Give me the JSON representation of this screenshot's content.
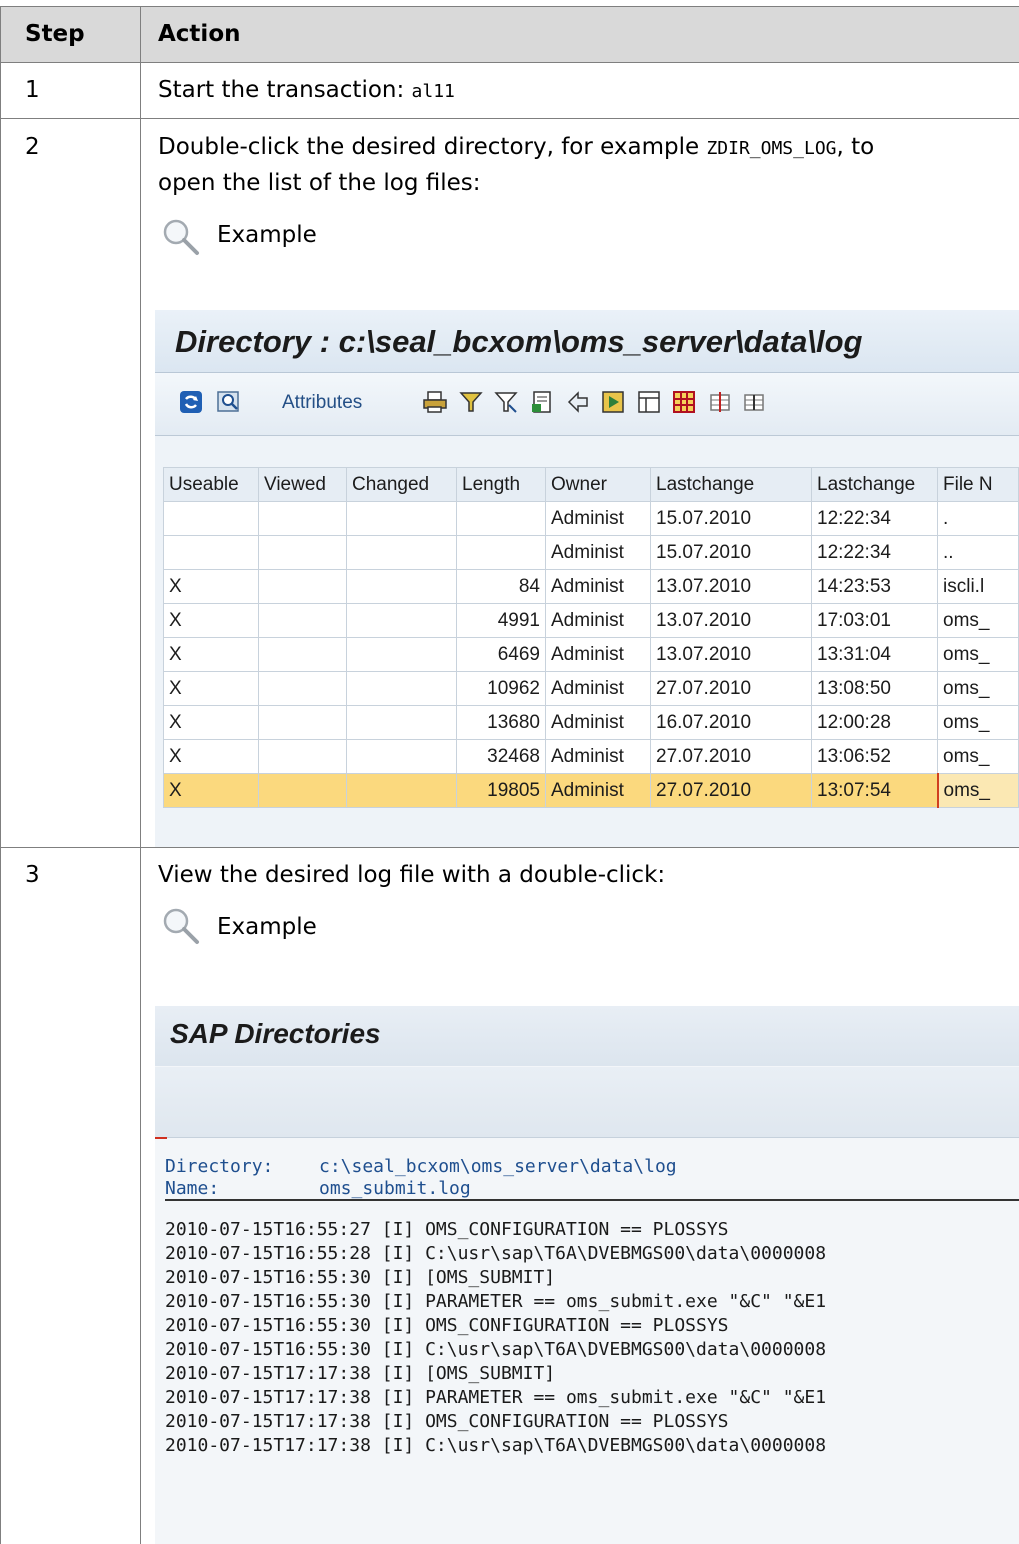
{
  "table": {
    "header": {
      "step": "Step",
      "action": "Action"
    }
  },
  "steps": [
    {
      "number": "1",
      "text": "Start the transaction: ",
      "code": "al11"
    },
    {
      "number": "2",
      "line1_a": "Double-click the desired directory, for example ",
      "line1_code": "ZDIR_OMS_LOG",
      "line1_b": ", to",
      "line2": "open the list of the log files:",
      "example_label": "Example"
    },
    {
      "number": "3",
      "text": "View the desired log file with a double-click:",
      "example_label": "Example"
    }
  ],
  "directory_screen": {
    "title": "Directory : c:\\seal_bcxom\\oms_server\\data\\log",
    "toolbar": {
      "attributes_label": "Attributes",
      "icons": [
        "refresh-icon",
        "find-icon",
        "print-icon",
        "filter-icon",
        "filter-set-icon",
        "export-icon",
        "sort-icon",
        "download-icon",
        "layout-icon",
        "grid-icon",
        "insert-column-icon",
        "delete-column-icon"
      ]
    },
    "columns": [
      "Useable",
      "Viewed",
      "Changed",
      "Length",
      "Owner",
      "Lastchange",
      "Lastchange",
      "File N"
    ],
    "rows": [
      [
        "",
        "",
        "",
        "",
        "Administ",
        "15.07.2010",
        "12:22:34",
        "."
      ],
      [
        "",
        "",
        "",
        "",
        "Administ",
        "15.07.2010",
        "12:22:34",
        ".."
      ],
      [
        "X",
        "",
        "",
        "84",
        "Administ",
        "13.07.2010",
        "14:23:53",
        "iscli.l"
      ],
      [
        "X",
        "",
        "",
        "4991",
        "Administ",
        "13.07.2010",
        "17:03:01",
        "oms_"
      ],
      [
        "X",
        "",
        "",
        "6469",
        "Administ",
        "13.07.2010",
        "13:31:04",
        "oms_"
      ],
      [
        "X",
        "",
        "",
        "10962",
        "Administ",
        "27.07.2010",
        "13:08:50",
        "oms_"
      ],
      [
        "X",
        "",
        "",
        "13680",
        "Administ",
        "16.07.2010",
        "12:00:28",
        "oms_"
      ],
      [
        "X",
        "",
        "",
        "32468",
        "Administ",
        "27.07.2010",
        "13:06:52",
        "oms_"
      ],
      [
        "X",
        "",
        "",
        "19805",
        "Administ",
        "27.07.2010",
        "13:07:54",
        "oms_"
      ]
    ],
    "selected_row_index": 8,
    "selection_color": "#fbd97e"
  },
  "file_screen": {
    "title": "SAP Directories",
    "directory_label": "Directory:",
    "directory_value": "c:\\seal_bcxom\\oms_server\\data\\log",
    "name_label": "Name:",
    "name_value": "oms_submit.log",
    "log_lines": [
      "2010-07-15T16:55:27 [I] OMS_CONFIGURATION == PLOSSYS",
      "2010-07-15T16:55:28 [I] C:\\usr\\sap\\T6A\\DVEBMGS00\\data\\0000008",
      "2010-07-15T16:55:30 [I] [OMS_SUBMIT]",
      "2010-07-15T16:55:30 [I] PARAMETER == oms_submit.exe \"&C\" \"&E1",
      "2010-07-15T16:55:30 [I] OMS_CONFIGURATION == PLOSSYS",
      "2010-07-15T16:55:30 [I] C:\\usr\\sap\\T6A\\DVEBMGS00\\data\\0000008",
      "2010-07-15T17:17:38 [I] [OMS_SUBMIT]",
      "2010-07-15T17:17:38 [I] PARAMETER == oms_submit.exe \"&C\" \"&E1",
      "2010-07-15T17:17:38 [I] OMS_CONFIGURATION == PLOSSYS",
      "2010-07-15T17:17:38 [I] C:\\usr\\sap\\T6A\\DVEBMGS00\\data\\0000008"
    ]
  },
  "colors": {
    "header_bg": "#d9d9d9",
    "border": "#7f7f7f",
    "sap_blue": "#1f4f8f"
  }
}
